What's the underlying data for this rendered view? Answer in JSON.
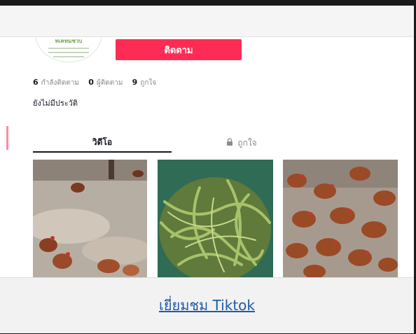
{
  "header": {
    "bg": "#f5f5f5"
  },
  "profile": {
    "avatar_text": "ทเคทมชวบ",
    "follow_label": "ติดตาม",
    "follow_color": "#fe2c55"
  },
  "stats": {
    "following": {
      "count": "6",
      "label": "กำลังติดตาม"
    },
    "followers": {
      "count": "0",
      "label": "ผู้ติดตาม"
    },
    "likes": {
      "count": "9",
      "label": "ถูกใจ"
    }
  },
  "bio": "ยังไม่มีประวัติ",
  "tabs": {
    "videos": "วิดีโอ",
    "liked": "ถูกใจ"
  },
  "videos": [
    {
      "subject": "chickens-on-ground"
    },
    {
      "subject": "green-beans-in-basket"
    },
    {
      "subject": "chicken-flock"
    }
  ],
  "footer": {
    "visit_label": "เยี่ยมชม Tiktok",
    "link_color": "#1e5aa8"
  }
}
